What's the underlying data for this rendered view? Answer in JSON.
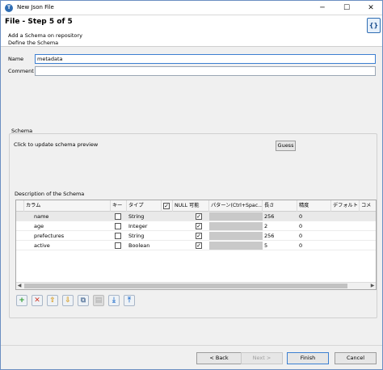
{
  "window": {
    "title": "New Json File",
    "controls": {
      "minimize": "─",
      "maximize": "☐",
      "close": "✕"
    }
  },
  "header": {
    "step_title": "File - Step 5 of 5",
    "subtitle1": "Add a Schema on repository",
    "subtitle2": "Define the Schema",
    "icon_text": "{}"
  },
  "form": {
    "name_label": "Name",
    "name_value": "metadata",
    "comment_label": "Comment",
    "comment_value": ""
  },
  "schema": {
    "group_label": "Schema",
    "preview_text": "Click to update schema preview",
    "guess_label": "Guess",
    "description_label": "Description of the Schema",
    "columns": [
      "カラム",
      "キー",
      "タイプ",
      "",
      "NULL 可能",
      "パターン(Ctrl+Spac...",
      "長さ",
      "精度",
      "デフォルト",
      "コメ"
    ],
    "rows": [
      {
        "name": "name",
        "key": false,
        "type": "String",
        "nullable": true,
        "length": "256",
        "precision": "0"
      },
      {
        "name": "age",
        "key": false,
        "type": "Integer",
        "nullable": true,
        "length": "2",
        "precision": "0"
      },
      {
        "name": "prefectures",
        "key": false,
        "type": "String",
        "nullable": true,
        "length": "256",
        "precision": "0"
      },
      {
        "name": "active",
        "key": false,
        "type": "Boolean",
        "nullable": true,
        "length": "5",
        "precision": "0"
      }
    ],
    "toolbar": [
      {
        "name": "add",
        "icon": "+",
        "color": "#2e9b2e"
      },
      {
        "name": "remove",
        "icon": "✕",
        "color": "#d23a2a"
      },
      {
        "name": "move-up",
        "icon": "⇧",
        "color": "#d89a1c"
      },
      {
        "name": "move-down",
        "icon": "⇩",
        "color": "#d89a1c"
      },
      {
        "name": "copy",
        "icon": "⧉",
        "color": "#6b86a8"
      },
      {
        "name": "paste",
        "icon": "▤",
        "color": "#aaaaaa"
      },
      {
        "name": "import",
        "icon": "⤓",
        "color": "#3c7fd1"
      },
      {
        "name": "export",
        "icon": "⤒",
        "color": "#3c7fd1"
      }
    ]
  },
  "nav": {
    "back": "< Back",
    "next": "Next >",
    "finish": "Finish",
    "cancel": "Cancel"
  }
}
